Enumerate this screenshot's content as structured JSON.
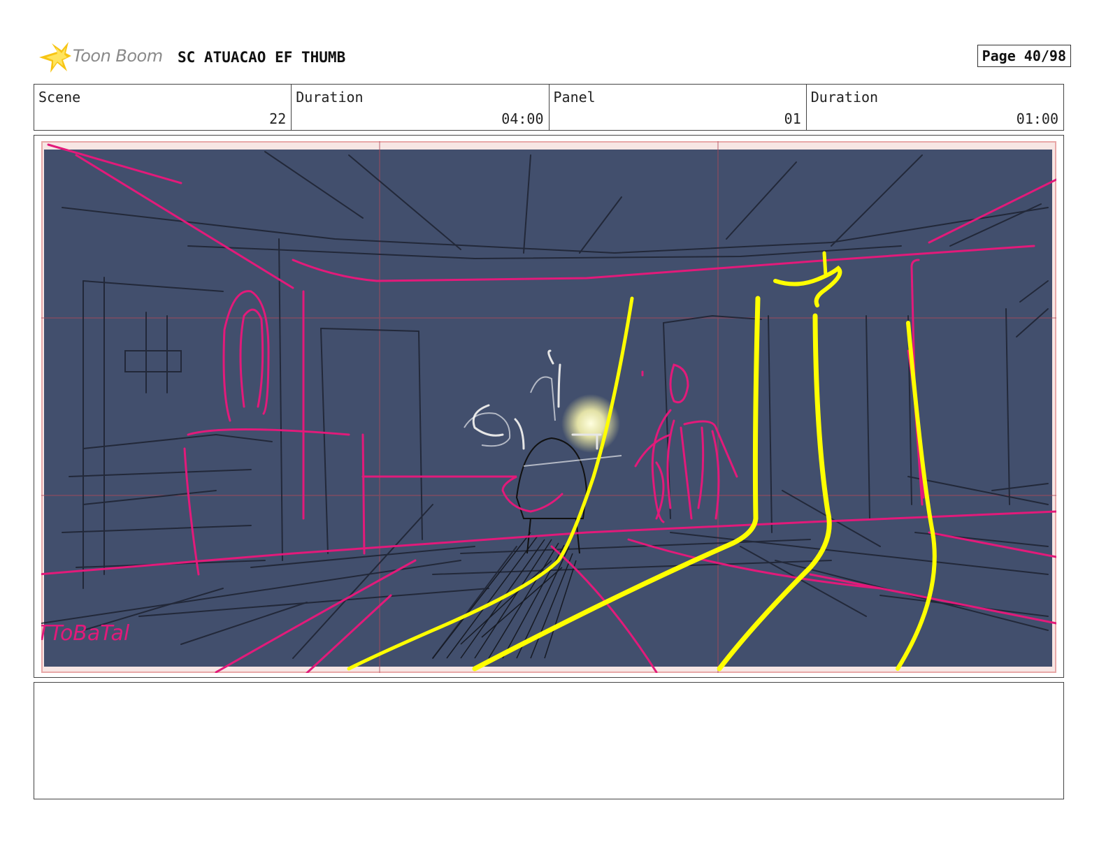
{
  "header": {
    "brand": "Toon Boom",
    "project_title": "SC ATUACAO EF THUMB",
    "page_label": "Page 40/98"
  },
  "info": {
    "scene_label": "Scene",
    "scene_value": "22",
    "duration_label": "Duration",
    "duration_value": "04:00",
    "panel_label": "Panel",
    "panel_value": "01",
    "panel_duration_label": "Duration",
    "panel_duration_value": "01:00"
  },
  "panel": {
    "sketch_signature": "TToBaTal"
  },
  "colors": {
    "background": "#424f6d",
    "magenta": "#e21a7a",
    "yellow": "#ffff00",
    "dark_line": "#1d2230"
  }
}
